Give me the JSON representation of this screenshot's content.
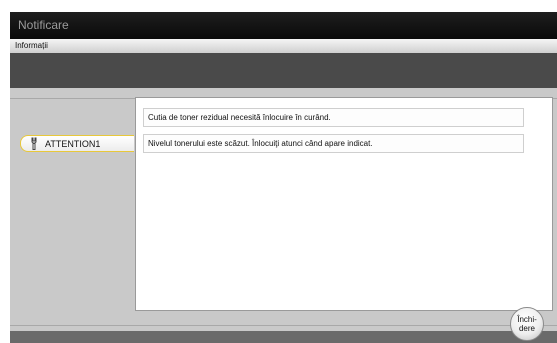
{
  "window": {
    "title": "Notificare"
  },
  "header": {
    "subtitle": "Informații"
  },
  "attention": {
    "label": "ATTENTION1",
    "icon": "wrench-icon",
    "border_color": "#e8c83a"
  },
  "messages": [
    {
      "text": "Cutia de toner rezidual necesită înlocuire în curând."
    },
    {
      "text": "Nivelul tonerului este scăzut. Înlocuiţi atunci când apare indicat."
    }
  ],
  "footer": {
    "close_label": "Închi-\ndere"
  }
}
